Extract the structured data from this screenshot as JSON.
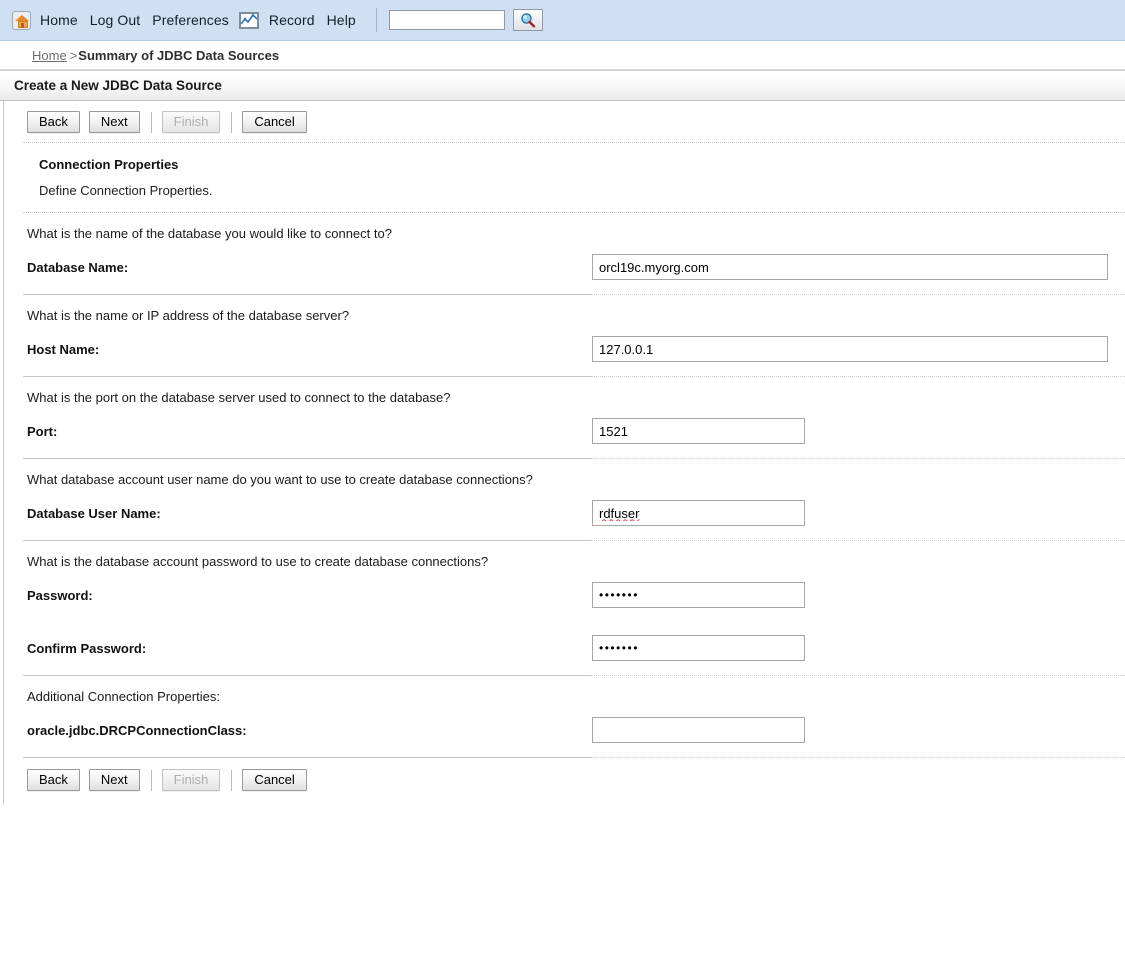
{
  "toolbar": {
    "home_label": "Home",
    "logout_label": "Log Out",
    "preferences_label": "Preferences",
    "record_label": "Record",
    "help_label": "Help",
    "search_value": "",
    "search_placeholder": "",
    "home_icon": "home-icon",
    "record_icon": "chart-record-icon",
    "search_icon": "magnifier-icon",
    "background_color": "#cfe0f2"
  },
  "breadcrumb": {
    "home": "Home",
    "separator": ">",
    "current": "Summary of JDBC Data Sources"
  },
  "page": {
    "title": "Create a New JDBC Data Source"
  },
  "buttons": {
    "back": "Back",
    "next": "Next",
    "finish": "Finish",
    "cancel": "Cancel",
    "finish_disabled": true
  },
  "step": {
    "heading": "Connection Properties",
    "subtitle": "Define Connection Properties."
  },
  "form": {
    "rows": [
      {
        "question": "What is the name of the database you would like to connect to?",
        "label": "Database Name:",
        "value": "orcl19c.myorg.com",
        "field_name": "database-name-input",
        "width": "xl",
        "type": "text"
      },
      {
        "question": "What is the name or IP address of the database server?",
        "label": "Host Name:",
        "value": "127.0.0.1",
        "field_name": "host-name-input",
        "width": "xl",
        "type": "text"
      },
      {
        "question": "What is the port on the database server used to connect to the database?",
        "label": "Port:",
        "value": "1521",
        "field_name": "port-input",
        "width": "md",
        "type": "text"
      },
      {
        "question": "What database account user name do you want to use to create database connections?",
        "label": "Database User Name:",
        "value": "rdfuser",
        "field_name": "database-user-name-input",
        "width": "md",
        "type": "text",
        "spellcheck_error": true
      },
      {
        "question": "What is the database account password to use to create database connections?",
        "label": "Password:",
        "value": "•••••••",
        "field_name": "password-input",
        "width": "md",
        "type": "password"
      },
      {
        "question": "",
        "label": "Confirm Password:",
        "value": "•••••••",
        "field_name": "confirm-password-input",
        "width": "md",
        "type": "password"
      },
      {
        "question": "Additional Connection Properties:",
        "label": "oracle.jdbc.DRCPConnectionClass:",
        "value": "",
        "field_name": "drcp-connection-class-input",
        "width": "md",
        "type": "text"
      }
    ]
  }
}
